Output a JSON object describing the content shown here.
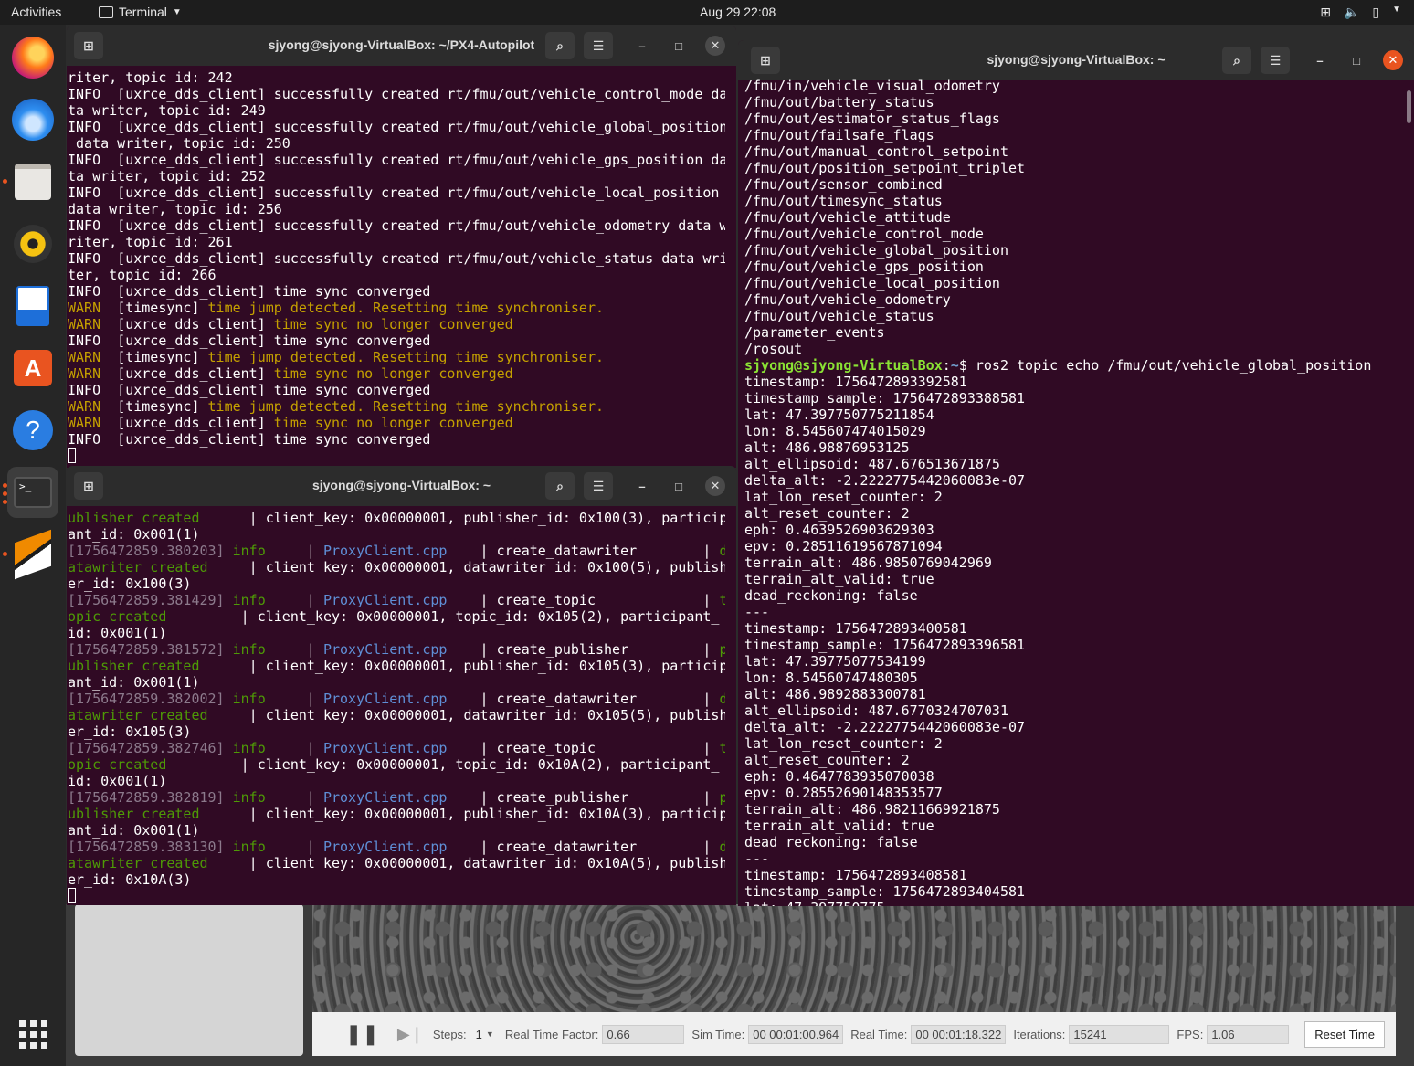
{
  "topbar": {
    "activities": "Activities",
    "app": "Terminal",
    "clock": "Aug 29  22:08"
  },
  "dock": {
    "items": [
      "firefox-icon",
      "thunderbird-icon",
      "files-icon",
      "rhythmbox-icon",
      "writer-icon",
      "software-icon",
      "help-icon",
      "terminal-icon",
      "qgroundcontrol-icon",
      "apps-grid-icon"
    ]
  },
  "term1": {
    "title": "sjyong@sjyong-VirtualBox: ~/PX4-Autopilot"
  },
  "term2": {
    "title": "sjyong@sjyong-VirtualBox: ~"
  },
  "term3": {
    "title": "sjyong@sjyong-VirtualBox: ~"
  },
  "term1_lines": [
    [
      [
        "riter, topic id: 242",
        ""
      ]
    ],
    [
      [
        "INFO  [uxrce_dds_client] successfully created rt/fmu/out/vehicle_control_mode da",
        ""
      ]
    ],
    [
      [
        "ta writer, topic id: 249",
        ""
      ]
    ],
    [
      [
        "INFO  [uxrce_dds_client] successfully created rt/fmu/out/vehicle_global_position",
        ""
      ]
    ],
    [
      [
        " data writer, topic id: 250",
        ""
      ]
    ],
    [
      [
        "INFO  [uxrce_dds_client] successfully created rt/fmu/out/vehicle_gps_position da",
        ""
      ]
    ],
    [
      [
        "ta writer, topic id: 252",
        ""
      ]
    ],
    [
      [
        "INFO  [uxrce_dds_client] successfully created rt/fmu/out/vehicle_local_position",
        ""
      ]
    ],
    [
      [
        "data writer, topic id: 256",
        ""
      ]
    ],
    [
      [
        "INFO  [uxrce_dds_client] successfully created rt/fmu/out/vehicle_odometry data w",
        ""
      ]
    ],
    [
      [
        "riter, topic id: 261",
        ""
      ]
    ],
    [
      [
        "INFO  [uxrce_dds_client] successfully created rt/fmu/out/vehicle_status data wri",
        ""
      ]
    ],
    [
      [
        "ter, topic id: 266",
        ""
      ]
    ],
    [
      [
        "INFO  [uxrce_dds_client] time sync converged",
        ""
      ]
    ],
    [
      [
        "WARN  ",
        "y"
      ],
      [
        "[timesync] ",
        ""
      ],
      [
        "time jump detected. Resetting time synchroniser.",
        "y"
      ]
    ],
    [
      [
        "WARN  ",
        "y"
      ],
      [
        "[uxrce_dds_client] ",
        ""
      ],
      [
        "time sync no longer converged",
        "y"
      ]
    ],
    [
      [
        "INFO  [uxrce_dds_client] time sync converged",
        ""
      ]
    ],
    [
      [
        "WARN  ",
        "y"
      ],
      [
        "[timesync] ",
        ""
      ],
      [
        "time jump detected. Resetting time synchroniser.",
        "y"
      ]
    ],
    [
      [
        "WARN  ",
        "y"
      ],
      [
        "[uxrce_dds_client] ",
        ""
      ],
      [
        "time sync no longer converged",
        "y"
      ]
    ],
    [
      [
        "INFO  [uxrce_dds_client] time sync converged",
        ""
      ]
    ],
    [
      [
        "WARN  ",
        "y"
      ],
      [
        "[timesync] ",
        ""
      ],
      [
        "time jump detected. Resetting time synchroniser.",
        "y"
      ]
    ],
    [
      [
        "WARN  ",
        "y"
      ],
      [
        "[uxrce_dds_client] ",
        ""
      ],
      [
        "time sync no longer converged",
        "y"
      ]
    ],
    [
      [
        "INFO  [uxrce_dds_client] time sync converged",
        ""
      ]
    ]
  ],
  "term2_lines": [
    [
      [
        "ublisher created",
        "g"
      ],
      [
        "      | client_key: 0x00000001, publisher_id: 0x100(3), particip",
        ""
      ]
    ],
    [
      [
        "ant_id: 0x001(1)",
        ""
      ]
    ],
    [
      [
        "[1756472859.380203] ",
        "gr"
      ],
      [
        "info",
        "g"
      ],
      [
        "     | ",
        ""
      ],
      [
        "ProxyClient.cpp",
        "b"
      ],
      [
        "    | create_datawriter        | ",
        ""
      ],
      [
        "d",
        "g"
      ]
    ],
    [
      [
        "atawriter created",
        "g"
      ],
      [
        "     | client_key: 0x00000001, datawriter_id: 0x100(5), publish",
        ""
      ]
    ],
    [
      [
        "er_id: 0x100(3)",
        ""
      ]
    ],
    [
      [
        "[1756472859.381429] ",
        "gr"
      ],
      [
        "info",
        "g"
      ],
      [
        "     | ",
        ""
      ],
      [
        "ProxyClient.cpp",
        "b"
      ],
      [
        "    | create_topic             | ",
        ""
      ],
      [
        "t",
        "g"
      ]
    ],
    [
      [
        "opic created",
        "g"
      ],
      [
        "         | client_key: 0x00000001, topic_id: 0x105(2), participant_",
        ""
      ]
    ],
    [
      [
        "id: 0x001(1)",
        ""
      ]
    ],
    [
      [
        "[1756472859.381572] ",
        "gr"
      ],
      [
        "info",
        "g"
      ],
      [
        "     | ",
        ""
      ],
      [
        "ProxyClient.cpp",
        "b"
      ],
      [
        "    | create_publisher         | ",
        ""
      ],
      [
        "p",
        "g"
      ]
    ],
    [
      [
        "ublisher created",
        "g"
      ],
      [
        "      | client_key: 0x00000001, publisher_id: 0x105(3), particip",
        ""
      ]
    ],
    [
      [
        "ant_id: 0x001(1)",
        ""
      ]
    ],
    [
      [
        "[1756472859.382002] ",
        "gr"
      ],
      [
        "info",
        "g"
      ],
      [
        "     | ",
        ""
      ],
      [
        "ProxyClient.cpp",
        "b"
      ],
      [
        "    | create_datawriter        | ",
        ""
      ],
      [
        "d",
        "g"
      ]
    ],
    [
      [
        "atawriter created",
        "g"
      ],
      [
        "     | client_key: 0x00000001, datawriter_id: 0x105(5), publish",
        ""
      ]
    ],
    [
      [
        "er_id: 0x105(3)",
        ""
      ]
    ],
    [
      [
        "[1756472859.382746] ",
        "gr"
      ],
      [
        "info",
        "g"
      ],
      [
        "     | ",
        ""
      ],
      [
        "ProxyClient.cpp",
        "b"
      ],
      [
        "    | create_topic             | ",
        ""
      ],
      [
        "t",
        "g"
      ]
    ],
    [
      [
        "opic created",
        "g"
      ],
      [
        "         | client_key: 0x00000001, topic_id: 0x10A(2), participant_",
        ""
      ]
    ],
    [
      [
        "id: 0x001(1)",
        ""
      ]
    ],
    [
      [
        "[1756472859.382819] ",
        "gr"
      ],
      [
        "info",
        "g"
      ],
      [
        "     | ",
        ""
      ],
      [
        "ProxyClient.cpp",
        "b"
      ],
      [
        "    | create_publisher         | ",
        ""
      ],
      [
        "p",
        "g"
      ]
    ],
    [
      [
        "ublisher created",
        "g"
      ],
      [
        "      | client_key: 0x00000001, publisher_id: 0x10A(3), particip",
        ""
      ]
    ],
    [
      [
        "ant_id: 0x001(1)",
        ""
      ]
    ],
    [
      [
        "[1756472859.383130] ",
        "gr"
      ],
      [
        "info",
        "g"
      ],
      [
        "     | ",
        ""
      ],
      [
        "ProxyClient.cpp",
        "b"
      ],
      [
        "    | create_datawriter        | ",
        ""
      ],
      [
        "d",
        "g"
      ]
    ],
    [
      [
        "atawriter created",
        "g"
      ],
      [
        "     | client_key: 0x00000001, datawriter_id: 0x10A(5), publish",
        ""
      ]
    ],
    [
      [
        "er_id: 0x10A(3)",
        ""
      ]
    ]
  ],
  "term3_lines": [
    [
      [
        "/fmu/in/vehicle_visual_odometry",
        ""
      ]
    ],
    [
      [
        "/fmu/out/battery_status",
        ""
      ]
    ],
    [
      [
        "/fmu/out/estimator_status_flags",
        ""
      ]
    ],
    [
      [
        "/fmu/out/failsafe_flags",
        ""
      ]
    ],
    [
      [
        "/fmu/out/manual_control_setpoint",
        ""
      ]
    ],
    [
      [
        "/fmu/out/position_setpoint_triplet",
        ""
      ]
    ],
    [
      [
        "/fmu/out/sensor_combined",
        ""
      ]
    ],
    [
      [
        "/fmu/out/timesync_status",
        ""
      ]
    ],
    [
      [
        "/fmu/out/vehicle_attitude",
        ""
      ]
    ],
    [
      [
        "/fmu/out/vehicle_control_mode",
        ""
      ]
    ],
    [
      [
        "/fmu/out/vehicle_global_position",
        ""
      ]
    ],
    [
      [
        "/fmu/out/vehicle_gps_position",
        ""
      ]
    ],
    [
      [
        "/fmu/out/vehicle_local_position",
        ""
      ]
    ],
    [
      [
        "/fmu/out/vehicle_odometry",
        ""
      ]
    ],
    [
      [
        "/fmu/out/vehicle_status",
        ""
      ]
    ],
    [
      [
        "/parameter_events",
        ""
      ]
    ],
    [
      [
        "/rosout",
        ""
      ]
    ],
    [
      [
        "sjyong@sjyong-VirtualBox",
        "pg"
      ],
      [
        ":",
        ""
      ],
      [
        "~",
        "pb"
      ],
      [
        "$ ros2 topic echo /fmu/out/vehicle_global_position",
        ""
      ]
    ],
    [
      [
        "timestamp: 1756472893392581",
        ""
      ]
    ],
    [
      [
        "timestamp_sample: 1756472893388581",
        ""
      ]
    ],
    [
      [
        "lat: 47.397750775211854",
        ""
      ]
    ],
    [
      [
        "lon: 8.545607474015029",
        ""
      ]
    ],
    [
      [
        "alt: 486.98876953125",
        ""
      ]
    ],
    [
      [
        "alt_ellipsoid: 487.676513671875",
        ""
      ]
    ],
    [
      [
        "delta_alt: -2.2222775442060083e-07",
        ""
      ]
    ],
    [
      [
        "lat_lon_reset_counter: 2",
        ""
      ]
    ],
    [
      [
        "alt_reset_counter: 2",
        ""
      ]
    ],
    [
      [
        "eph: 0.4639526903629303",
        ""
      ]
    ],
    [
      [
        "epv: 0.28511619567871094",
        ""
      ]
    ],
    [
      [
        "terrain_alt: 486.9850769042969",
        ""
      ]
    ],
    [
      [
        "terrain_alt_valid: true",
        ""
      ]
    ],
    [
      [
        "dead_reckoning: false",
        ""
      ]
    ],
    [
      [
        "---",
        ""
      ]
    ],
    [
      [
        "timestamp: 1756472893400581",
        ""
      ]
    ],
    [
      [
        "timestamp_sample: 1756472893396581",
        ""
      ]
    ],
    [
      [
        "lat: 47.39775077534199",
        ""
      ]
    ],
    [
      [
        "lon: 8.54560747480305",
        ""
      ]
    ],
    [
      [
        "alt: 486.9892883300781",
        ""
      ]
    ],
    [
      [
        "alt_ellipsoid: 487.6770324707031",
        ""
      ]
    ],
    [
      [
        "delta_alt: -2.2222775442060083e-07",
        ""
      ]
    ],
    [
      [
        "lat_lon_reset_counter: 2",
        ""
      ]
    ],
    [
      [
        "alt_reset_counter: 2",
        ""
      ]
    ],
    [
      [
        "eph: 0.4647783935070038",
        ""
      ]
    ],
    [
      [
        "epv: 0.28552690148353577",
        ""
      ]
    ],
    [
      [
        "terrain_alt: 486.98211669921875",
        ""
      ]
    ],
    [
      [
        "terrain_alt_valid: true",
        ""
      ]
    ],
    [
      [
        "dead_reckoning: false",
        ""
      ]
    ],
    [
      [
        "---",
        ""
      ]
    ],
    [
      [
        "timestamp: 1756472893408581",
        ""
      ]
    ],
    [
      [
        "timestamp_sample: 1756472893404581",
        ""
      ]
    ],
    [
      [
        "lat: 47.397750775",
        ""
      ]
    ]
  ],
  "gazebo": {
    "steps_label": "Steps:",
    "steps_value": "1",
    "rtf_label": "Real Time Factor:",
    "rtf_value": "0.66",
    "sim_label": "Sim Time:",
    "sim_value": "00 00:01:00.964",
    "real_label": "Real Time:",
    "real_value": "00 00:01:18.322",
    "iter_label": "Iterations:",
    "iter_value": "15241",
    "fps_label": "FPS:",
    "fps_value": "1.06",
    "reset_label": "Reset Time"
  },
  "colors": {
    "terminal_bg": "#300a24",
    "titlebar_bg": "#2c2c2c",
    "close_active": "#e95420",
    "warn": "#c4a000",
    "info_green": "#4e9a06",
    "prompt_green": "#8ae234",
    "path_blue": "#729fcf"
  }
}
